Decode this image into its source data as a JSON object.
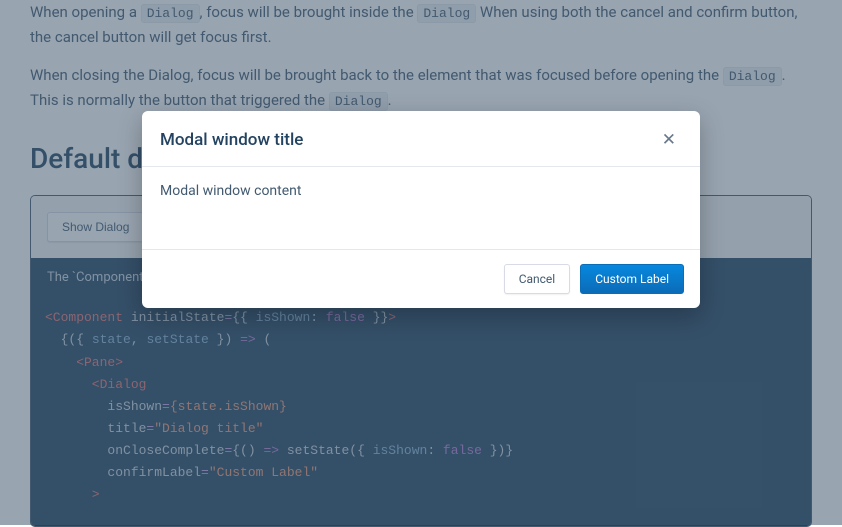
{
  "doc": {
    "p1_a": "When opening a ",
    "p1_code1": "Dialog",
    "p1_b": ", focus will be brought inside the ",
    "p1_code2": "Dialog",
    "p1_c": " When using both the cancel and confirm button, the cancel button will get focus first.",
    "p2_a": "When closing the Dialog, focus will be brought back to the element that was focused before opening the ",
    "p2_code1": "Dialog",
    "p2_b": ". This is normally the button that triggered the ",
    "p2_code2": "Dialog",
    "p2_c": "."
  },
  "heading": "Default dialog example",
  "example": {
    "show_button": "Show Dialog",
    "caption": "The `Component` component is not part of Evergreen. It is only used for these examples to manage state.",
    "code": {
      "l1a": "<Component",
      "l1b": " initialState",
      "l1c": "=",
      "l1d": "{{ ",
      "l1e": "isShown",
      "l1f": ": ",
      "l1g": "false",
      "l1h": " }}",
      "l1i": ">",
      "l2a": "  {({ ",
      "l2b": "state",
      "l2c": ", ",
      "l2d": "setState",
      "l2e": " }) ",
      "l2f": "=>",
      "l2g": " (",
      "l3a": "    <Pane",
      "l3b": ">",
      "l4a": "      <Dialog",
      "l5a": "        isShown",
      "l5b": "=",
      "l5c": "{state.isShown}",
      "l6a": "        title",
      "l6b": "=",
      "l6c": "\"Dialog title\"",
      "l7a": "        onCloseComplete",
      "l7b": "=",
      "l7c": "{() ",
      "l7d": "=>",
      "l7e": " setState({ ",
      "l7f": "isShown",
      "l7g": ": ",
      "l7h": "false",
      "l7i": " })}",
      "l8a": "        confirmLabel",
      "l8b": "=",
      "l8c": "\"Custom Label\"",
      "l9a": "      >"
    }
  },
  "modal": {
    "title": "Modal window title",
    "close": "✕",
    "content": "Modal window content",
    "cancel": "Cancel",
    "confirm": "Custom Label"
  }
}
